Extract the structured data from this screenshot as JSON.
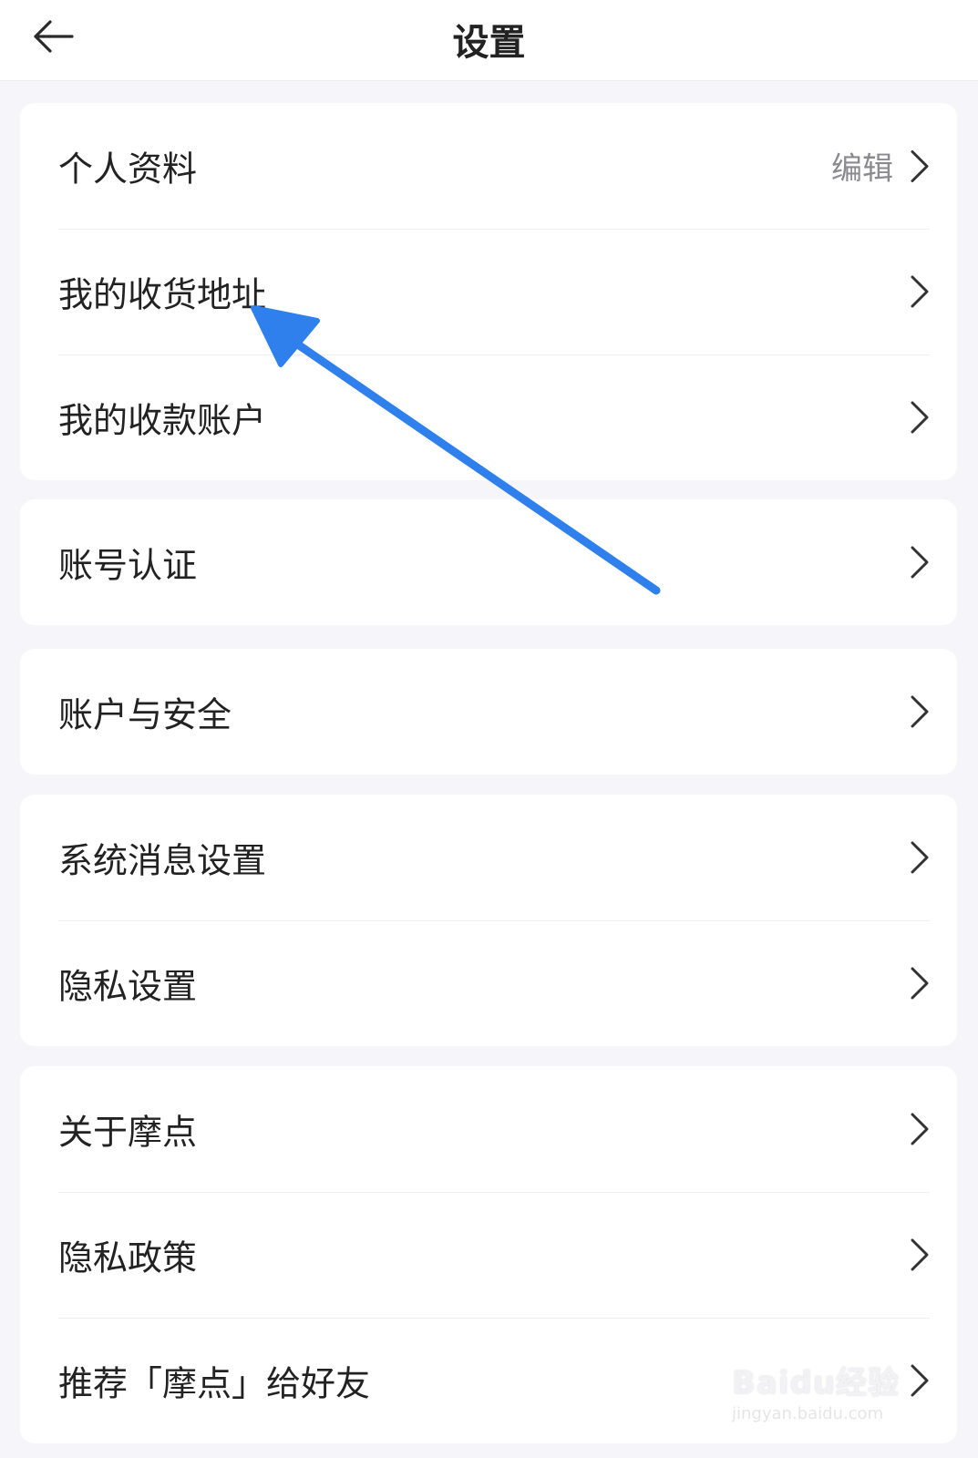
{
  "header": {
    "title": "设置",
    "back_icon": "arrow-left-icon"
  },
  "groups": [
    {
      "items": [
        {
          "label": "个人资料",
          "value": "编辑"
        },
        {
          "label": "我的收货地址"
        },
        {
          "label": "我的收款账户"
        }
      ]
    },
    {
      "items": [
        {
          "label": "账号认证"
        }
      ]
    },
    {
      "items": [
        {
          "label": "账户与安全"
        }
      ]
    },
    {
      "items": [
        {
          "label": "系统消息设置"
        },
        {
          "label": "隐私设置"
        }
      ]
    },
    {
      "items": [
        {
          "label": "关于摩点"
        },
        {
          "label": "隐私政策"
        },
        {
          "label": "推荐「摩点」给好友"
        }
      ]
    }
  ],
  "watermark": {
    "main": "Baidu经验",
    "sub": "jingyan.baidu.com"
  },
  "colors": {
    "background": "#f6f6fa",
    "card": "#ffffff",
    "text": "#222222",
    "muted": "#8a8a8f",
    "annotation_arrow": "#2f80ed"
  }
}
